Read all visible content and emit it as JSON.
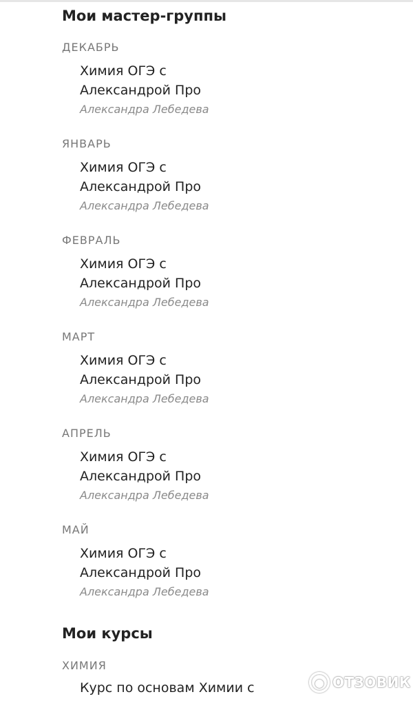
{
  "groups_section": {
    "title": "Мои мастер-группы",
    "months": [
      {
        "month": "ДЕКАБРЬ",
        "title_line1": "Химия ОГЭ с",
        "title_line2": "Александрой Про",
        "author": "Александра Лебедева"
      },
      {
        "month": "ЯНВАРЬ",
        "title_line1": "Химия ОГЭ с",
        "title_line2": "Александрой Про",
        "author": "Александра Лебедева"
      },
      {
        "month": "ФЕВРАЛЬ",
        "title_line1": "Химия ОГЭ с",
        "title_line2": "Александрой Про",
        "author": "Александра Лебедева"
      },
      {
        "month": "МАРТ",
        "title_line1": "Химия ОГЭ с",
        "title_line2": "Александрой Про",
        "author": "Александра Лебедева"
      },
      {
        "month": "АПРЕЛЬ",
        "title_line1": "Химия ОГЭ с",
        "title_line2": "Александрой Про",
        "author": "Александра Лебедева"
      },
      {
        "month": "МАЙ",
        "title_line1": "Химия ОГЭ с",
        "title_line2": "Александрой Про",
        "author": "Александра Лебедева"
      }
    ]
  },
  "courses_section": {
    "title": "Мои курсы",
    "subject": "ХИМИЯ",
    "course_title": "Курс по основам Химии с"
  },
  "watermark": {
    "text": "ОТЗОВИК",
    "icon": "otzovik-logo-icon"
  }
}
